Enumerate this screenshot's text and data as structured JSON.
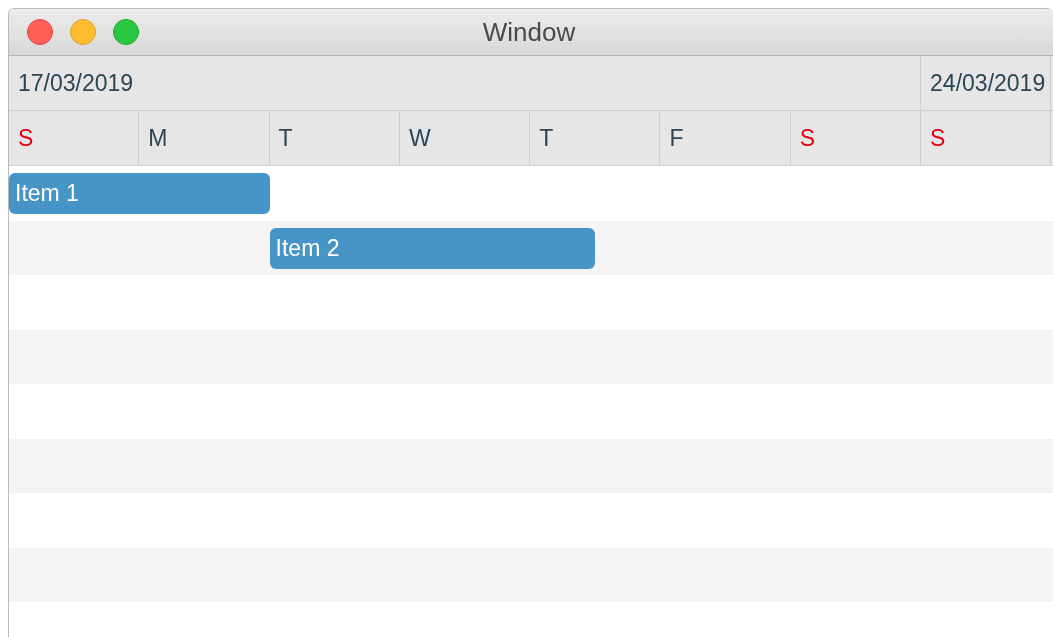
{
  "window": {
    "title": "Window"
  },
  "weeks": [
    "17/03/2019",
    "24/03/2019"
  ],
  "days": [
    {
      "label": "S",
      "color": "#e3000f"
    },
    {
      "label": "M",
      "color": "#2b4555"
    },
    {
      "label": "T",
      "color": "#2b4555"
    },
    {
      "label": "W",
      "color": "#2b4555"
    },
    {
      "label": "T",
      "color": "#2b4555"
    },
    {
      "label": "F",
      "color": "#2b4555"
    },
    {
      "label": "S",
      "color": "#e3000f"
    },
    {
      "label": "S",
      "color": "#e3000f"
    }
  ],
  "items": [
    {
      "label": "Item 1"
    },
    {
      "label": "Item 2"
    }
  ]
}
